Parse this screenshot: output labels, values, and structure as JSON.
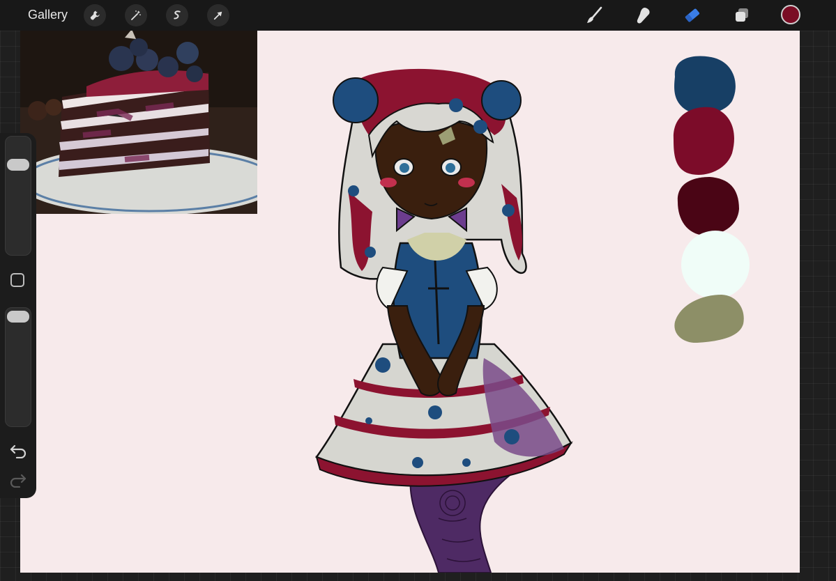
{
  "topbar": {
    "gallery_label": "Gallery",
    "left_tools": [
      "wrench-icon",
      "magic-wand-icon",
      "selection-icon",
      "transform-arrow-icon"
    ],
    "right_tools": [
      "brush-icon",
      "smudge-icon",
      "eraser-icon",
      "layers-icon"
    ],
    "active_tool": "eraser-icon",
    "current_color": "#7a0c24"
  },
  "sidebar": {
    "icons": [
      "brush-size-slider",
      "modify-square-icon",
      "opacity-slider",
      "undo-icon",
      "redo-icon"
    ]
  },
  "palette": {
    "colors": [
      "#173f65",
      "#7c0c29",
      "#4a0515",
      "#f0fdf8",
      "#8d8f67"
    ]
  },
  "colors": {
    "canvas_bg": "#f7eaeb",
    "accent_blue": "#3a7ee8"
  }
}
